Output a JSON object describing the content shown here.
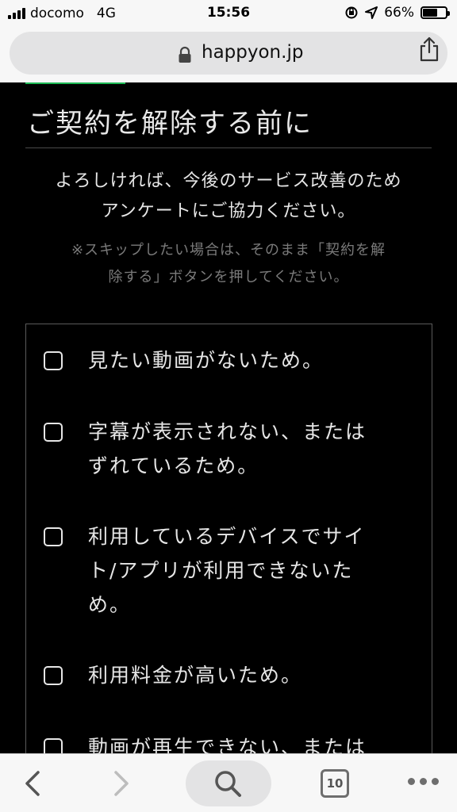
{
  "status_bar": {
    "carrier": "docomo",
    "network": "4G",
    "time": "15:56",
    "battery_percent": "66%",
    "battery_level": 0.66
  },
  "url_bar": {
    "domain": "happyon.jp"
  },
  "page": {
    "title": "ご契約を解除する前に",
    "intro_line1": "よろしければ、今後のサービス改善のため",
    "intro_line2": "アンケートにご協力ください。",
    "note_line1": "※スキップしたい場合は、そのまま「契約を解",
    "note_line2": "除する」ボタンを押してください。",
    "options": [
      {
        "line1": "見たい動画がないため。",
        "line2": "",
        "line3": ""
      },
      {
        "line1": "字幕が表示されない、または",
        "line2": "ずれているため。",
        "line3": ""
      },
      {
        "line1": "利用しているデバイスでサイ",
        "line2": "ト/アプリが利用できないた",
        "line3": "め。"
      },
      {
        "line1": "利用料金が高いため。",
        "line2": "",
        "line3": ""
      },
      {
        "line1": "動画が再生できない、または",
        "line2": "",
        "line3": ""
      }
    ]
  },
  "toolbar": {
    "tab_count": "10"
  },
  "colors": {
    "background": "#000000",
    "accent_line": "#1db954",
    "text": "#e6e6e6",
    "note_text": "#7a7a7a"
  },
  "icons": [
    "lock-icon",
    "share-icon",
    "back-icon",
    "forward-icon",
    "search-icon",
    "tabs-icon",
    "more-icon",
    "location-arrow-icon",
    "orientation-lock-icon"
  ]
}
